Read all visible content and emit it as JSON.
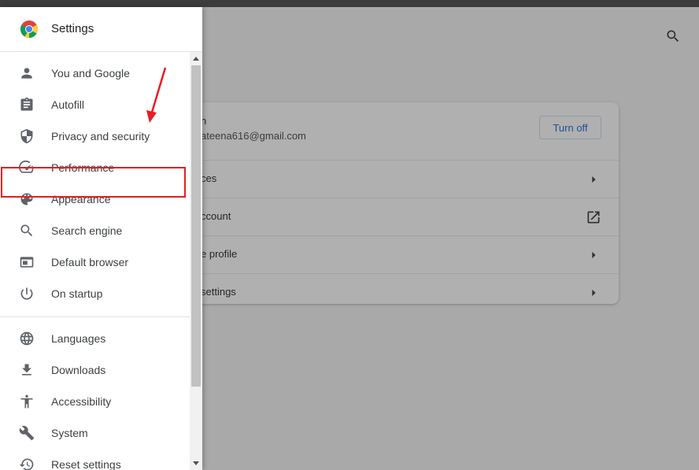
{
  "drawer": {
    "title": "Settings",
    "items": [
      {
        "label": "You and Google",
        "icon": "person-icon"
      },
      {
        "label": "Autofill",
        "icon": "clipboard-icon"
      },
      {
        "label": "Privacy and security",
        "icon": "shield-icon"
      },
      {
        "label": "Performance",
        "icon": "speedometer-icon"
      },
      {
        "label": "Appearance",
        "icon": "palette-icon"
      },
      {
        "label": "Search engine",
        "icon": "search-icon"
      },
      {
        "label": "Default browser",
        "icon": "browser-window-icon"
      },
      {
        "label": "On startup",
        "icon": "power-icon"
      },
      {
        "label": "Languages",
        "icon": "globe-icon"
      },
      {
        "label": "Downloads",
        "icon": "download-icon"
      },
      {
        "label": "Accessibility",
        "icon": "accessibility-icon"
      },
      {
        "label": "System",
        "icon": "wrench-icon"
      },
      {
        "label": "Reset settings",
        "icon": "history-icon"
      }
    ]
  },
  "main": {
    "profile_name": "n",
    "profile_email": "ateena616@gmail.com",
    "turn_off_label": "Turn off",
    "rows": [
      {
        "label": "ces",
        "icon": "chevron-right-icon"
      },
      {
        "label": "ccount",
        "icon": "external-link-icon"
      },
      {
        "label": "e profile",
        "icon": "chevron-right-icon"
      },
      {
        "label": "settings",
        "icon": "chevron-right-icon"
      }
    ]
  },
  "colors": {
    "highlight": "#e81c23",
    "accent": "#1a73e8"
  }
}
